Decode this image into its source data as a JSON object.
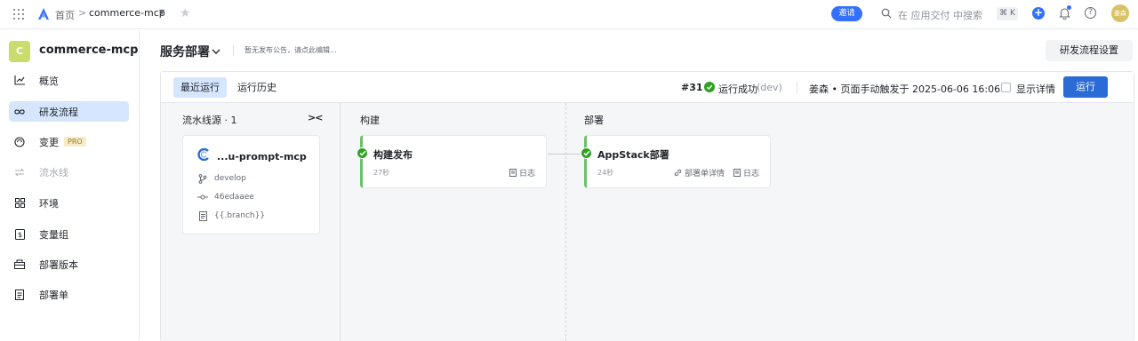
{
  "topbar": {
    "home": "首页",
    "separator": ">",
    "project": "commerce-mcp",
    "invite": "邀请",
    "search_placeholder": "在 应用交付 中搜索",
    "shortcut": "⌘ K",
    "plus": "+",
    "help": "?",
    "avatar_initials": "姜森"
  },
  "sidebar": {
    "project_badge": "C",
    "project_name": "commerce-mcp",
    "items": [
      {
        "label": "概览",
        "icon": "chart-line-icon"
      },
      {
        "label": "研发流程",
        "icon": "infinity-icon",
        "active": true
      },
      {
        "label": "变更",
        "icon": "change-icon",
        "badge": "PRO"
      },
      {
        "label": "流水线",
        "icon": "pipeline-icon",
        "disabled": true
      },
      {
        "label": "环境",
        "icon": "grid-icon"
      },
      {
        "label": "变量组",
        "icon": "variable-icon"
      },
      {
        "label": "部署版本",
        "icon": "package-icon"
      },
      {
        "label": "部署单",
        "icon": "document-icon"
      }
    ]
  },
  "main": {
    "title": "服务部署",
    "notice": "暂无发布公告，请点此编辑...",
    "settings_button": "研发流程设置"
  },
  "run_panel": {
    "tabs": [
      "最近运行",
      "运行历史"
    ],
    "run_number": "#31",
    "status": "运行成功",
    "env": "(dev)",
    "trigger": "姜森 • 页面手动触发于 2025-06-06 16:06",
    "show_details": "显示详情",
    "run_button": "运行"
  },
  "pipeline": {
    "source_title": "流水线源 · 1",
    "collapse": "><",
    "source": {
      "name": "...u-prompt-mcp",
      "branch": "develop",
      "commit": "46edaaee",
      "ref": "{{.branch}}"
    },
    "stages": [
      {
        "title": "构建",
        "job": {
          "name": "构建发布",
          "duration": "27秒",
          "log": "日志"
        }
      },
      {
        "title": "部署",
        "job": {
          "name": "AppStack部署",
          "duration": "24秒",
          "detail": "部署单详情",
          "log": "日志"
        }
      }
    ]
  },
  "colors": {
    "accent": "#3370ff",
    "run_button": "#2b6bd6",
    "success": "#2ea121",
    "active_nav": "#d6e6ff"
  }
}
